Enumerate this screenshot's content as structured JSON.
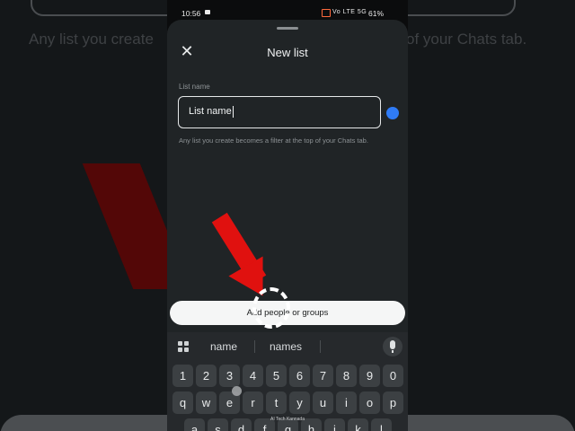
{
  "background": {
    "left_text": "Any list you create",
    "right_text": "of your Chats tab."
  },
  "status_bar": {
    "time": "10:56",
    "signal": "Vo LTE 5G",
    "battery": "61%"
  },
  "sheet": {
    "title": "New list",
    "field_label": "List name",
    "input_value": "List name",
    "helper_text": "Any list you create becomes a filter at the top of your Chats tab.",
    "add_button_label": "Add people or groups"
  },
  "keyboard": {
    "suggestions": [
      "name",
      "names"
    ],
    "number_row": [
      "1",
      "2",
      "3",
      "4",
      "5",
      "6",
      "7",
      "8",
      "9",
      "0"
    ],
    "letter_row": [
      "q",
      "w",
      "e",
      "r",
      "t",
      "y",
      "u",
      "i",
      "o",
      "p"
    ],
    "partial_row": [
      "a",
      "s",
      "d",
      "f",
      "g",
      "h",
      "j",
      "k",
      "l"
    ]
  },
  "watermark": "AI Tech Kannada",
  "colors": {
    "accent_blue": "#2f7bf5",
    "arrow_red": "#e0110f",
    "sheet_bg": "#202426"
  },
  "icons": {
    "close": "close-icon",
    "mic": "microphone-icon",
    "grid": "apps-grid-icon"
  }
}
